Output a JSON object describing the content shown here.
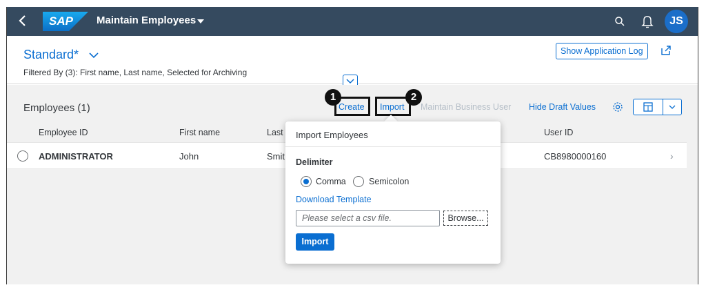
{
  "shell": {
    "logo_text": "SAP",
    "app_title": "Maintain Employees",
    "avatar_initials": "JS",
    "colors": {
      "bar": "#354a5f",
      "avatar": "#1b6ec9"
    }
  },
  "header": {
    "variant_name": "Standard*",
    "filter_text": "Filtered By (3): First name, Last name, Selected for Archiving",
    "show_log_label": "Show Application Log"
  },
  "table": {
    "title": "Employees (1)",
    "toolbar": {
      "create_label": "Create",
      "import_label": "Import",
      "maintain_label": "Maintain Business User",
      "hide_draft_label": "Hide Draft Values"
    },
    "columns": [
      "Employee ID",
      "First name",
      "Last",
      "User ID"
    ],
    "rows": [
      {
        "employee_id": "ADMINISTRATOR",
        "first_name": "John",
        "last_name": "Smit",
        "user_id": "CB8980000160"
      }
    ]
  },
  "callouts": {
    "one": "1",
    "two": "2"
  },
  "popover": {
    "title": "Import Employees",
    "delimiter_label": "Delimiter",
    "options": [
      "Comma",
      "Semicolon"
    ],
    "selected": "Comma",
    "download_label": "Download Template",
    "file_placeholder": "Please select a csv file.",
    "browse_label": "Browse...",
    "import_label": "Import"
  },
  "accent_color": "#0a6ed1"
}
